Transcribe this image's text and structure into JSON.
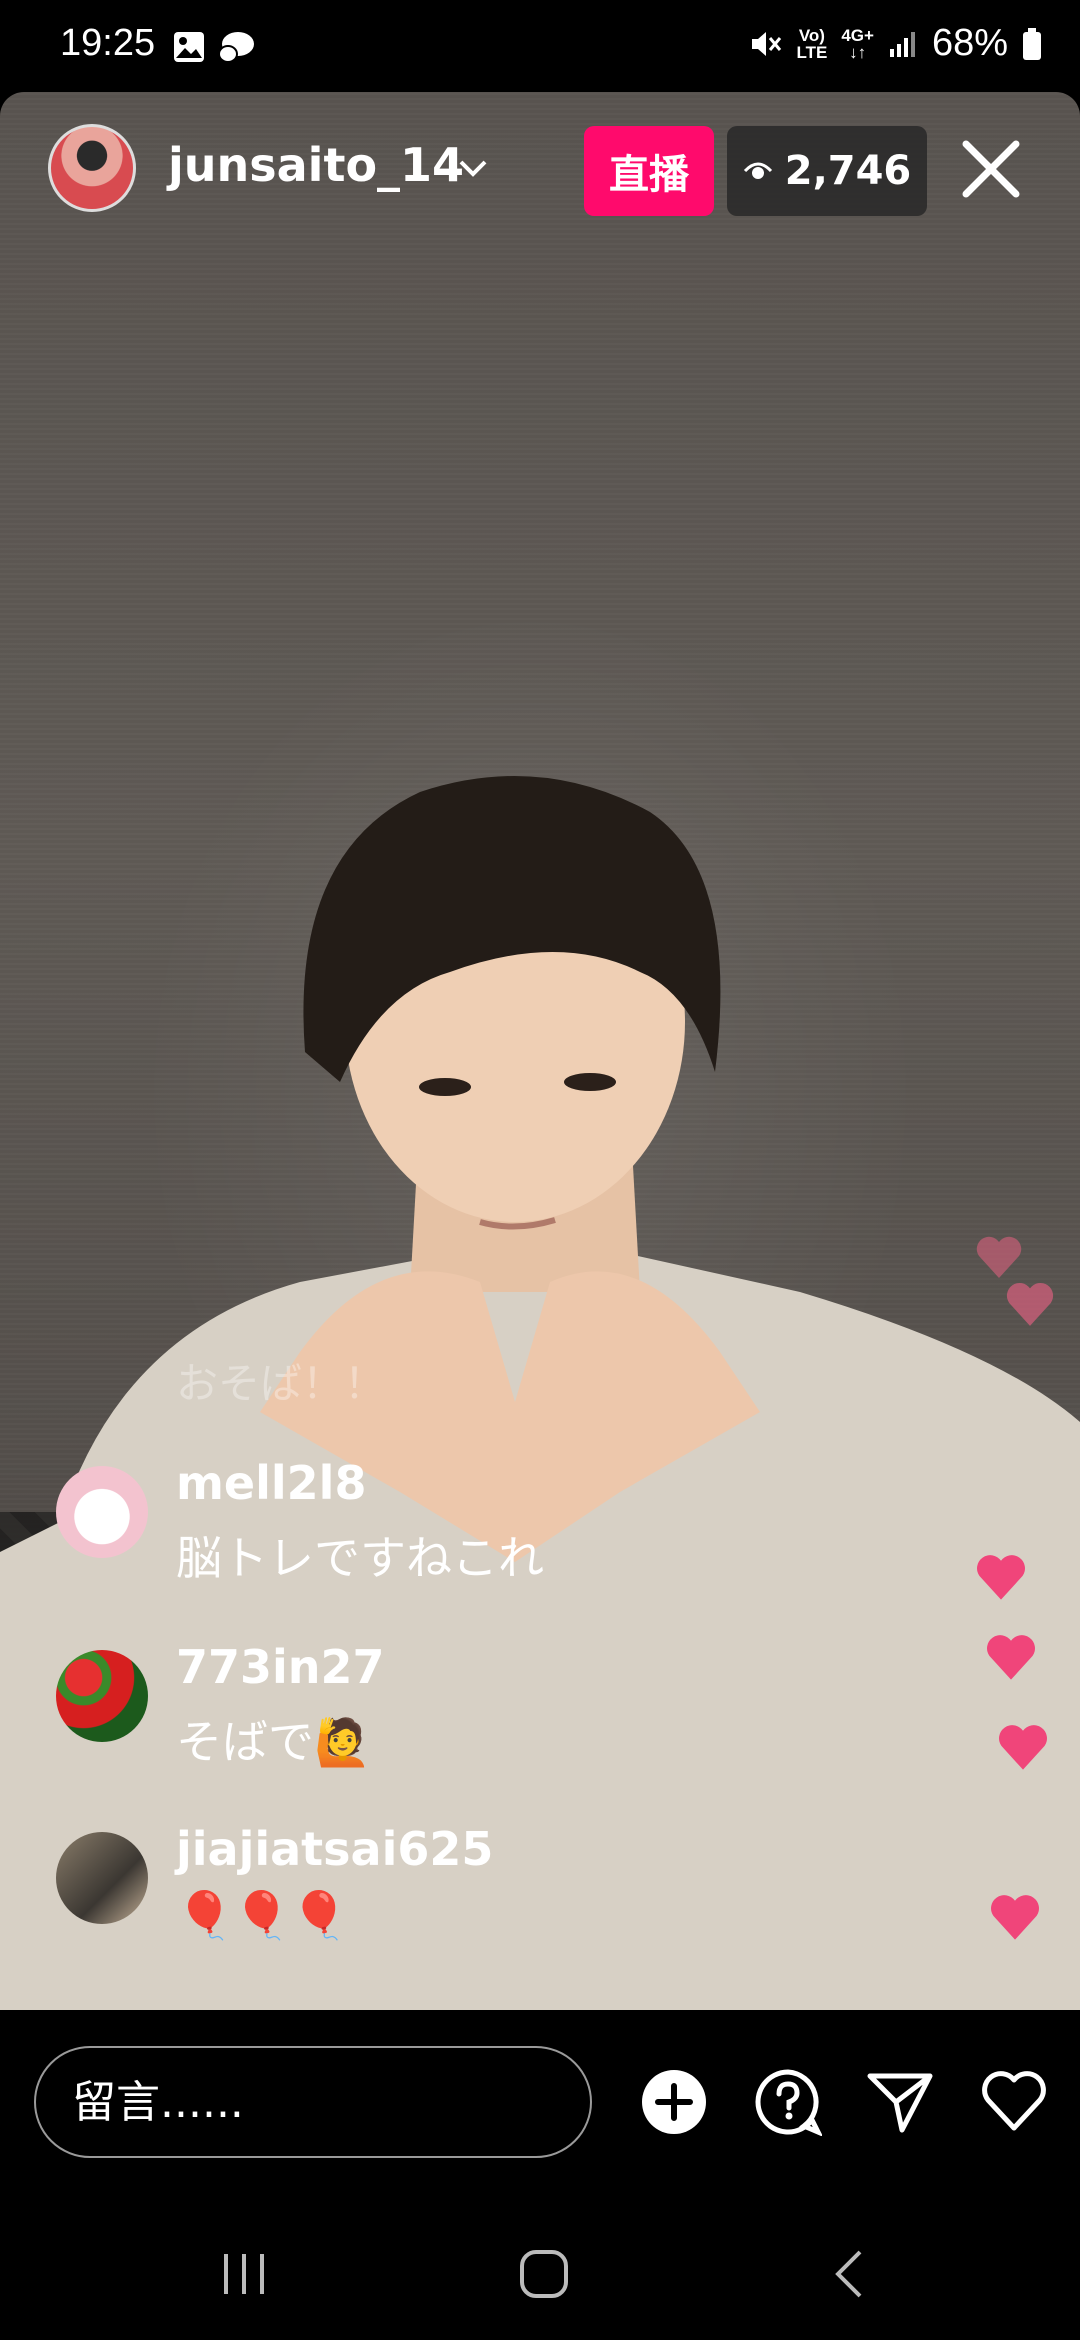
{
  "status": {
    "time": "19:25",
    "battery": "68%",
    "net_top": "Vo)",
    "net_bottom": "LTE",
    "data_top": "4G+",
    "data_bottom": "↓↑"
  },
  "live": {
    "host_username": "junsaito_14",
    "live_label": "直播",
    "viewer_count": "2,746"
  },
  "comments": {
    "ghost_text": "おそば！！",
    "items": [
      {
        "user": "mell2l8",
        "text": "脳トレですねこれ"
      },
      {
        "user": "773in27",
        "text": "そばで🙋"
      },
      {
        "user": "jiajiatsai625",
        "text": "🎈🎈🎈"
      }
    ]
  },
  "composer": {
    "placeholder": "留言......"
  },
  "colors": {
    "live_badge": "#ff0a6c",
    "heart": "#f0457a"
  },
  "icons": [
    "image-icon",
    "chat-bubble-icon",
    "mute-icon",
    "signal-icon",
    "battery-icon",
    "eye-icon",
    "close-icon",
    "add-icon",
    "question-icon",
    "send-icon",
    "heart-icon",
    "recents-icon",
    "home-icon",
    "back-icon"
  ]
}
